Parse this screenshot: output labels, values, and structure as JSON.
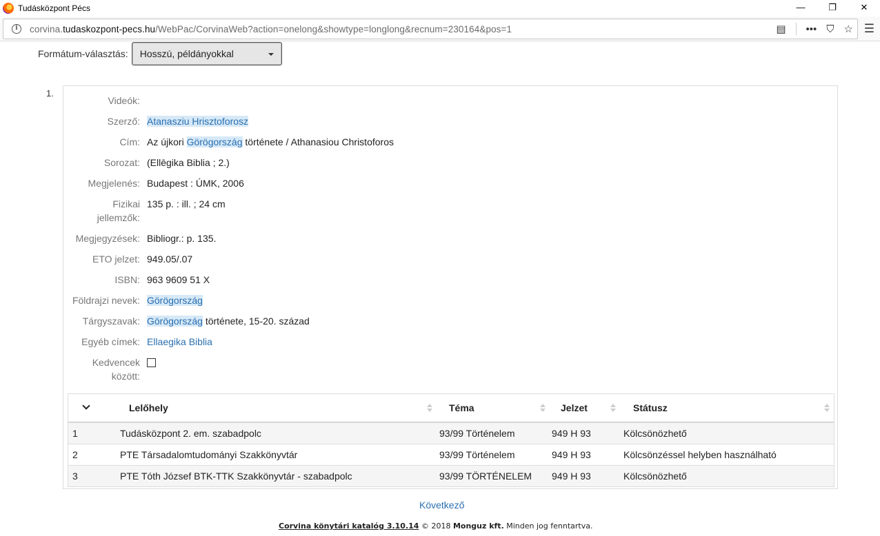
{
  "window": {
    "title": "Tudásközpont Pécs",
    "minimize": "—",
    "restore": "❐",
    "close": "✕"
  },
  "browser": {
    "url_prefix": "corvina.",
    "url_domain": "tudaskozpont-pecs.hu",
    "url_path": "/WebPac/CorvinaWeb?action=onelong&showtype=longlong&recnum=230164&pos=1",
    "reader_icon": "▤",
    "more_icon": "•••",
    "pocket_icon": "⛉",
    "star_icon": "☆",
    "menu_icon": "☰"
  },
  "format": {
    "label": "Formátum-választás:",
    "selected": "Hosszú, példányokkal"
  },
  "record": {
    "number": "1.",
    "fields": {
      "videok_label": "Videók:",
      "szerzo_label": "Szerző:",
      "szerzo_value": "Atanasziu Hrisztoforosz",
      "cim_label": "Cím:",
      "cim_pre": "Az újkori ",
      "cim_link": "Görögország",
      "cim_post": " története / Athanasiou Christoforos",
      "sorozat_label": "Sorozat:",
      "sorozat_value": "(Ellēgika Biblia ; 2.)",
      "megjelenes_label": "Megjelenés:",
      "megjelenes_value": "Budapest : ÚMK, 2006",
      "fizikai_label_1": "Fizikai",
      "fizikai_label_2": "jellemzők:",
      "fizikai_value": "135 p. : ill. ; 24 cm",
      "megjegyzesek_label": "Megjegyzések:",
      "megjegyzesek_value": "Bibliogr.: p. 135.",
      "eto_label": "ETO jelzet:",
      "eto_value": "949.05/.07",
      "isbn_label": "ISBN:",
      "isbn_value": "963 9609 51 X",
      "foldrajzi_label": "Földrajzi nevek:",
      "foldrajzi_value": "Görögország",
      "targyszavak_label": "Tárgyszavak:",
      "targyszavak_link": "Görögország",
      "targyszavak_post": " története, 15-20. század",
      "egyeb_label": "Egyéb címek:",
      "egyeb_value": "Ellaegika Biblia",
      "kedvencek_label_1": "Kedvencek",
      "kedvencek_label_2": "között:"
    }
  },
  "holdings": {
    "columns": {
      "location": "Lelőhely",
      "topic": "Téma",
      "callno": "Jelzet",
      "status": "Státusz"
    },
    "rows": [
      {
        "n": "1",
        "location": "Tudásközpont 2. em. szabadpolc",
        "topic": "93/99 Történelem",
        "callno": "949 H 93",
        "status": "Kölcsönözhető"
      },
      {
        "n": "2",
        "location": "PTE Társadalomtudományi Szakkönyvtár",
        "topic": "93/99 Történelem",
        "callno": "949 H 93",
        "status": "Kölcsönzéssel helyben használható"
      },
      {
        "n": "3",
        "location": "PTE Tóth József BTK-TTK Szakkönyvtár - szabadpolc",
        "topic": "93/99 TÖRTÉNELEM",
        "callno": "949 H 93",
        "status": "Kölcsönözhető"
      }
    ]
  },
  "next_link": "Következő",
  "footer": {
    "product": "Corvina könytári katalóg 3.10.14",
    "copyright": " © 2018 ",
    "company": "Monguz kft.",
    "rights": " Minden jog fenntartva."
  }
}
